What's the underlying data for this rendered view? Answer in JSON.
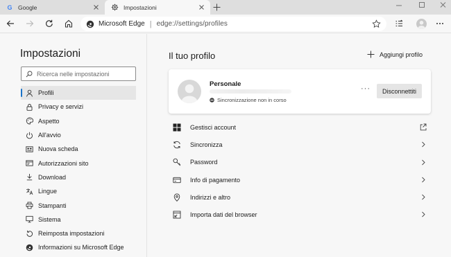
{
  "tabs": [
    {
      "title": "Google"
    },
    {
      "title": "Impostazioni"
    }
  ],
  "address": {
    "site": "Microsoft Edge",
    "separator": "|",
    "url": "edge://settings/profiles"
  },
  "sidebar": {
    "title": "Impostazioni",
    "search_placeholder": "Ricerca nelle impostazioni",
    "items": [
      {
        "label": "Profili",
        "icon": "person-icon",
        "active": true
      },
      {
        "label": "Privacy e servizi",
        "icon": "lock-icon"
      },
      {
        "label": "Aspetto",
        "icon": "palette-icon"
      },
      {
        "label": "All'avvio",
        "icon": "power-icon"
      },
      {
        "label": "Nuova scheda",
        "icon": "new-tab-page-icon"
      },
      {
        "label": "Autorizzazioni sito",
        "icon": "site-permissions-icon"
      },
      {
        "label": "Download",
        "icon": "download-icon"
      },
      {
        "label": "Lingue",
        "icon": "languages-icon"
      },
      {
        "label": "Stampanti",
        "icon": "printer-icon"
      },
      {
        "label": "Sistema",
        "icon": "system-icon"
      },
      {
        "label": "Reimposta impostazioni",
        "icon": "reset-icon"
      },
      {
        "label": "Informazioni su Microsoft Edge",
        "icon": "edge-logo-icon"
      }
    ]
  },
  "main": {
    "title": "Il tuo profilo",
    "add_profile_label": "Aggiungi profilo",
    "profile": {
      "name": "Personale",
      "sync_status": "Sincronizzazione non in corso",
      "more_label": "···",
      "disconnect_label": "Disconnettiti"
    },
    "rows": [
      {
        "label": "Gestisci account",
        "icon": "windows-icon",
        "trail": "external-link-icon"
      },
      {
        "label": "Sincronizza",
        "icon": "sync-icon",
        "trail": "chevron-right-icon"
      },
      {
        "label": "Password",
        "icon": "key-icon",
        "trail": "chevron-right-icon"
      },
      {
        "label": "Info di pagamento",
        "icon": "credit-card-icon",
        "trail": "chevron-right-icon"
      },
      {
        "label": "Indirizzi e altro",
        "icon": "location-pin-icon",
        "trail": "chevron-right-icon"
      },
      {
        "label": "Importa dati del browser",
        "icon": "import-icon",
        "trail": "chevron-right-icon"
      }
    ]
  },
  "colors": {
    "accent": "#1a73c8",
    "tab_strip": "#dedede",
    "page_bg": "#f7f7f7"
  }
}
